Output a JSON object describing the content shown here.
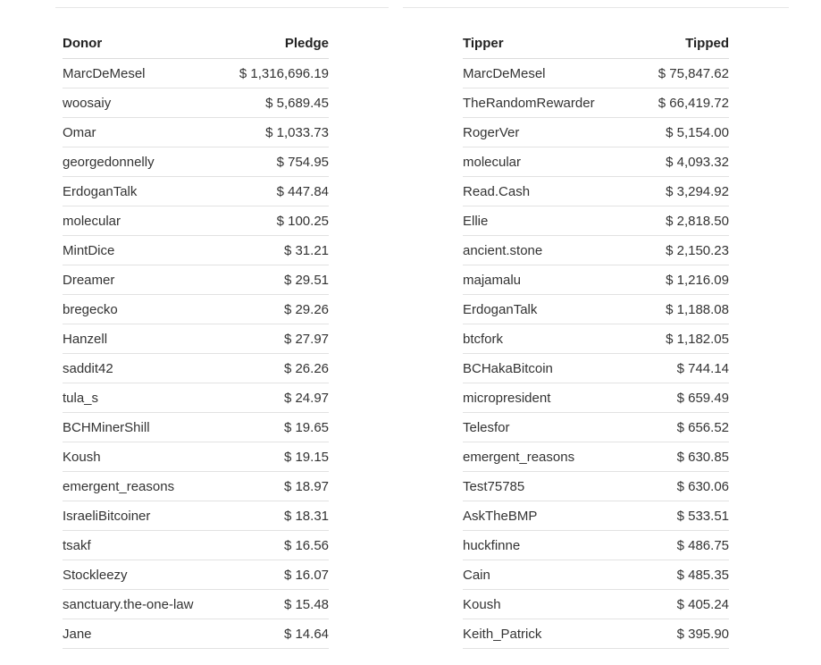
{
  "donors": {
    "headers": {
      "name": "Donor",
      "amount": "Pledge"
    },
    "rows": [
      {
        "name": "MarcDeMesel",
        "amount": "$ 1,316,696.19"
      },
      {
        "name": "woosaiy",
        "amount": "$ 5,689.45"
      },
      {
        "name": "Omar",
        "amount": "$ 1,033.73"
      },
      {
        "name": "georgedonnelly",
        "amount": "$ 754.95"
      },
      {
        "name": "ErdoganTalk",
        "amount": "$ 447.84"
      },
      {
        "name": "molecular",
        "amount": "$ 100.25"
      },
      {
        "name": "MintDice",
        "amount": "$ 31.21"
      },
      {
        "name": "Dreamer",
        "amount": "$ 29.51"
      },
      {
        "name": "bregecko",
        "amount": "$ 29.26"
      },
      {
        "name": "Hanzell",
        "amount": "$ 27.97"
      },
      {
        "name": "saddit42",
        "amount": "$ 26.26"
      },
      {
        "name": "tula_s",
        "amount": "$ 24.97"
      },
      {
        "name": "BCHMinerShill",
        "amount": "$ 19.65"
      },
      {
        "name": "Koush",
        "amount": "$ 19.15"
      },
      {
        "name": "emergent_reasons",
        "amount": "$ 18.97"
      },
      {
        "name": "IsraeliBitcoiner",
        "amount": "$ 18.31"
      },
      {
        "name": "tsakf",
        "amount": "$ 16.56"
      },
      {
        "name": "Stockleezy",
        "amount": "$ 16.07"
      },
      {
        "name": "sanctuary.the-one-law",
        "amount": "$ 15.48"
      },
      {
        "name": "Jane",
        "amount": "$ 14.64"
      }
    ]
  },
  "tippers": {
    "headers": {
      "name": "Tipper",
      "amount": "Tipped"
    },
    "rows": [
      {
        "name": "MarcDeMesel",
        "amount": "$ 75,847.62"
      },
      {
        "name": "TheRandomRewarder",
        "amount": "$ 66,419.72"
      },
      {
        "name": "RogerVer",
        "amount": "$ 5,154.00"
      },
      {
        "name": "molecular",
        "amount": "$ 4,093.32"
      },
      {
        "name": "Read.Cash",
        "amount": "$ 3,294.92"
      },
      {
        "name": "Ellie",
        "amount": "$ 2,818.50"
      },
      {
        "name": "ancient.stone",
        "amount": "$ 2,150.23"
      },
      {
        "name": "majamalu",
        "amount": "$ 1,216.09"
      },
      {
        "name": "ErdoganTalk",
        "amount": "$ 1,188.08"
      },
      {
        "name": "btcfork",
        "amount": "$ 1,182.05"
      },
      {
        "name": "BCHakaBitcoin",
        "amount": "$ 744.14"
      },
      {
        "name": "micropresident",
        "amount": "$ 659.49"
      },
      {
        "name": "Telesfor",
        "amount": "$ 656.52"
      },
      {
        "name": "emergent_reasons",
        "amount": "$ 630.85"
      },
      {
        "name": "Test75785",
        "amount": "$ 630.06"
      },
      {
        "name": "AskTheBMP",
        "amount": "$ 533.51"
      },
      {
        "name": "huckfinne",
        "amount": "$ 486.75"
      },
      {
        "name": "Cain",
        "amount": "$ 485.35"
      },
      {
        "name": "Koush",
        "amount": "$ 405.24"
      },
      {
        "name": "Keith_Patrick",
        "amount": "$ 395.90"
      }
    ]
  }
}
